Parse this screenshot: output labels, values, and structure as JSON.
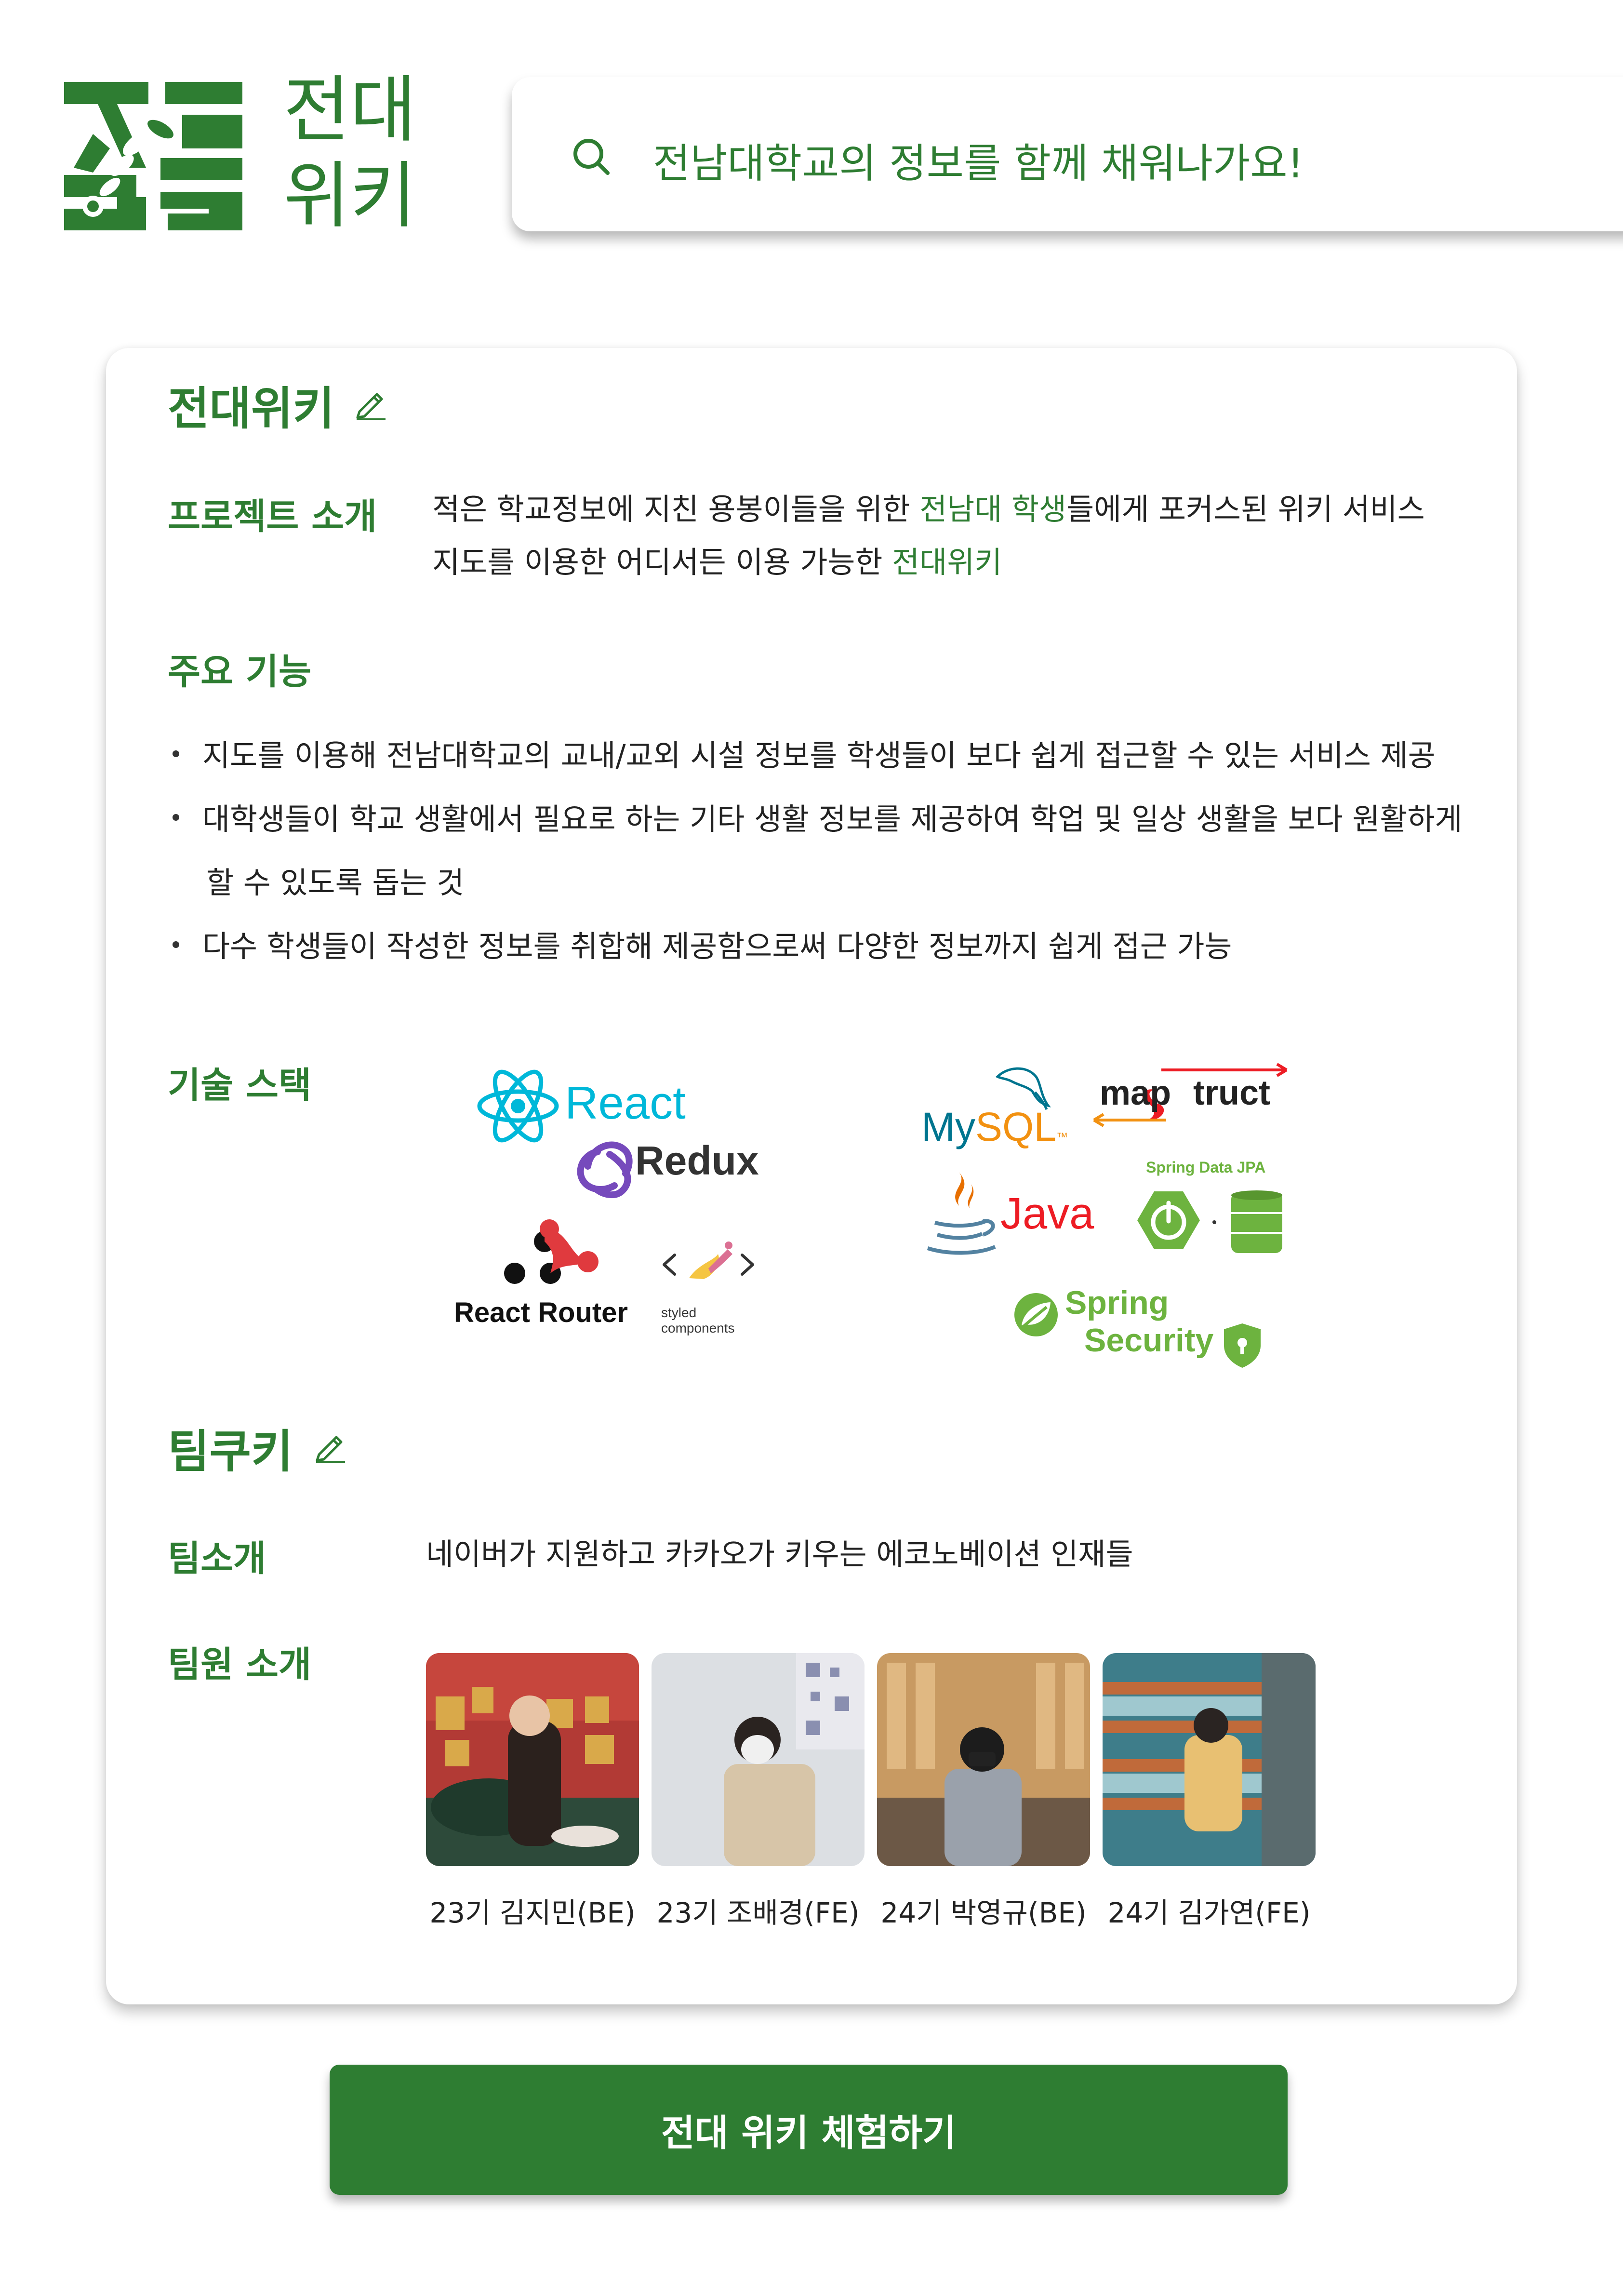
{
  "header": {
    "logo_line1": "전대",
    "logo_line2": "위키",
    "search_placeholder": "전남대학교의 정보를 함께 채워나가요!"
  },
  "project": {
    "title": "전대위키",
    "intro_label": "프로젝트 소개",
    "intro_line1_a": "적은 학교정보에 지친 용봉이들을 위한 ",
    "intro_line1_hl": "전남대 학생",
    "intro_line1_b": "들에게 포커스된 위키 서비스",
    "intro_line2_a": "지도를 이용한 어디서든 이용 가능한 ",
    "intro_line2_hl": "전대위키",
    "features_label": "주요 기능",
    "features": [
      "지도를 이용해 전남대학교의 교내/교외 시설 정보를 학생들이 보다 쉽게 접근할 수 있는 서비스 제공",
      "대학생들이 학교 생활에서 필요로 하는 기타 생활 정보를 제공하여 학업 및 일상 생활을 보다 원활하게",
      "할 수 있도록 돕는 것",
      "다수 학생들이 작성한 정보를 취합해 제공함으로써 다양한 정보까지 쉽게 접근 가능"
    ],
    "stack_label": "기술 스택",
    "stack": {
      "react": "React",
      "redux": "Redux",
      "react_router": "React Router",
      "styled1": "styled",
      "styled2": "components",
      "mysql_a": "My",
      "mysql_b": "SQL",
      "mysql_tm": "™",
      "mapstruct_a": "map",
      "mapstruct_b": "truct",
      "java": "Java",
      "spring_data_jpa": "Spring Data JPA",
      "spring": "Spring",
      "security": "Security"
    }
  },
  "team": {
    "title": "팀쿠키",
    "intro_label": "팀소개",
    "intro_text": "네이버가 지원하고 카카오가 키우는 에코노베이션 인재들",
    "members_label": "팀원 소개",
    "members": [
      {
        "name": "23기 김지민(BE)"
      },
      {
        "name": "23기 조배경(FE)"
      },
      {
        "name": "24기 박영규(BE)"
      },
      {
        "name": "24기 김가연(FE)"
      }
    ]
  },
  "cta": {
    "label": "전대 위키 체험하기"
  },
  "colors": {
    "brand": "#2e7d32",
    "text": "#222222",
    "background": "#ffffff"
  }
}
